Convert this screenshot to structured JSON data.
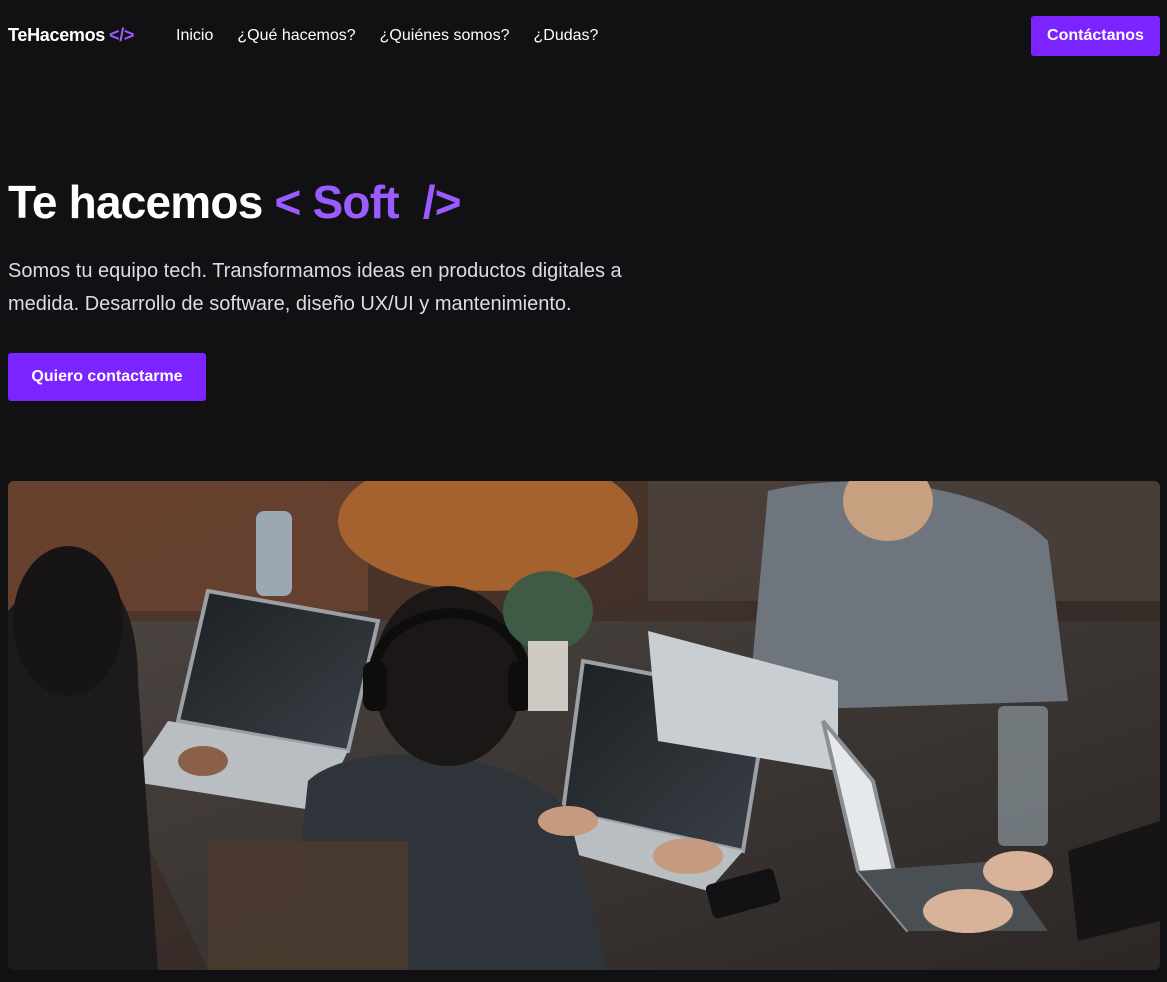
{
  "nav": {
    "logo_text": "TeHacemos",
    "logo_accent": "</>",
    "links": [
      "Inicio",
      "¿Qué hacemos?",
      "¿Quiénes somos?",
      "¿Dudas?"
    ],
    "cta_label": "Contáctanos"
  },
  "hero": {
    "title_main": "Te hacemos",
    "title_accent": "< Soft  />",
    "description": "Somos tu equipo tech. Transformamos ideas en productos digitales a medida. Desarrollo de software, diseño UX/UI y mantenimiento.",
    "button_label": "Quiero contactarme"
  },
  "colors": {
    "background": "#111012",
    "accent": "#7c24ff",
    "accent_text": "#9b5cff"
  }
}
